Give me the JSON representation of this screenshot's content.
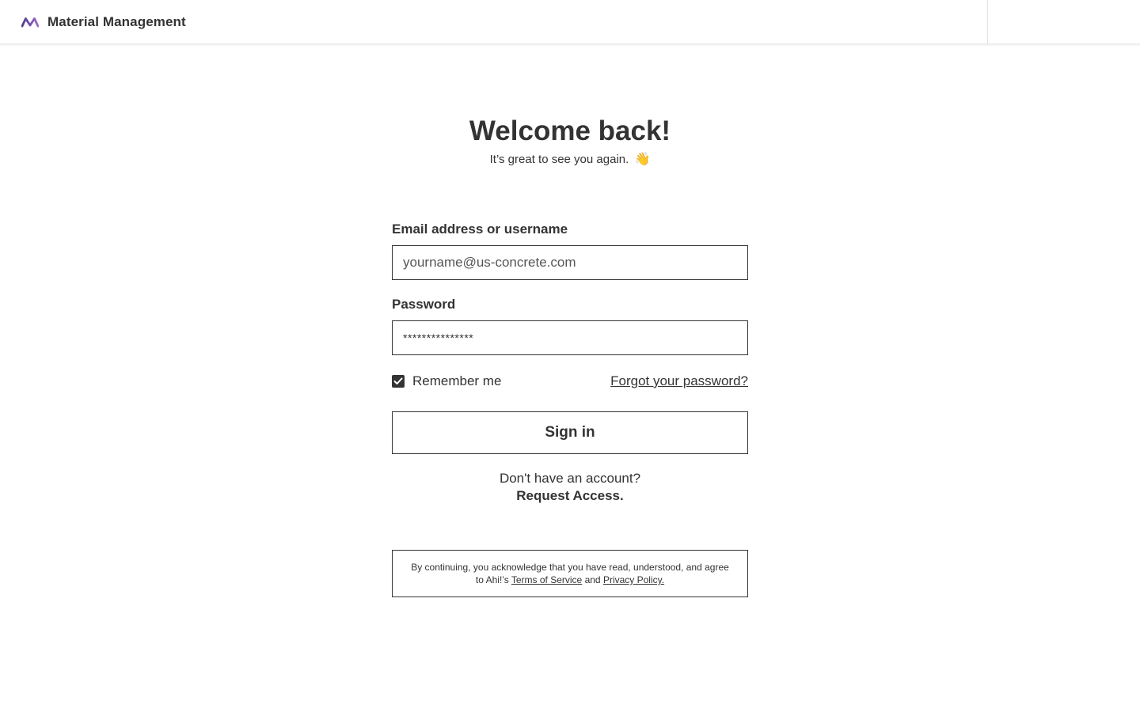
{
  "header": {
    "app_name": "Material Management",
    "logo_icon": "ahi-m-logo-icon",
    "logo_colors": [
      "#4b3b8f",
      "#a068c8"
    ]
  },
  "main": {
    "title": "Welcome back!",
    "subtitle": "It’s great to see you again.",
    "subtitle_icon": "👋"
  },
  "form": {
    "email_label": "Email address or username",
    "email_placeholder": "yourname@us-concrete.com",
    "password_label": "Password",
    "password_value": "***************",
    "remember_label": "Remember me",
    "remember_checked": true,
    "forgot_link": "Forgot your password?",
    "signin_label": "Sign in",
    "no_account_text": "Don't have an account?",
    "request_access": "Request Access."
  },
  "legal": {
    "prefix": "By continuing, you acknowledge that you have read, understood, and agree to Ahi!’s",
    "terms_link": "Terms of Service",
    "and": "and",
    "privacy_link": "Privacy Policy."
  }
}
